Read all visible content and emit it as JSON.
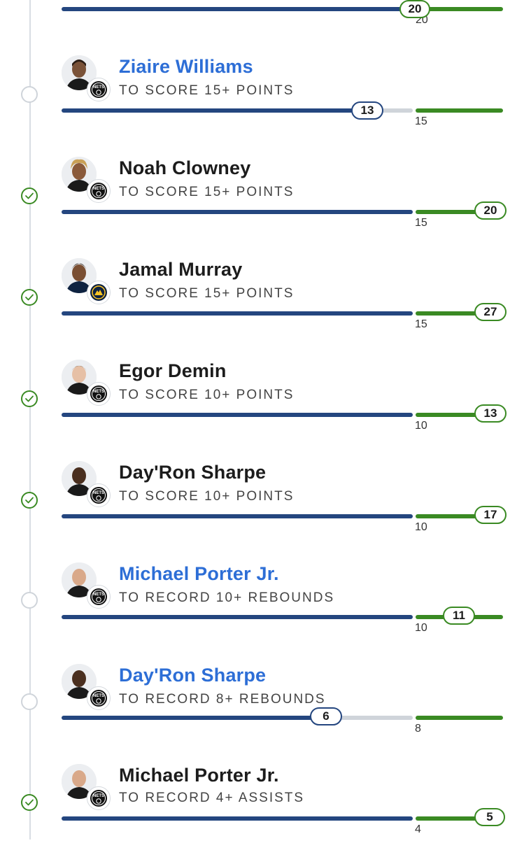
{
  "colors": {
    "progress": "#24467f",
    "remaining": "#cfd4da",
    "target": "#3a8a23",
    "link": "#2d6ed6",
    "timeline": "#d9dde3"
  },
  "top_partial": {
    "current": "20",
    "threshold": "20"
  },
  "props": [
    {
      "player": "Ziaire Williams",
      "team_icon": "nets-logo-icon",
      "prop": "TO SCORE 15+ POINTS",
      "threshold": "15",
      "current": "13",
      "status": "pending",
      "link": true
    },
    {
      "player": "Noah Clowney",
      "team_icon": "nets-logo-icon",
      "prop": "TO SCORE 15+ POINTS",
      "threshold": "15",
      "current": "20",
      "status": "hit",
      "link": false
    },
    {
      "player": "Jamal Murray",
      "team_icon": "nuggets-logo-icon",
      "prop": "TO SCORE 15+ POINTS",
      "threshold": "15",
      "current": "27",
      "status": "hit",
      "link": false
    },
    {
      "player": "Egor Demin",
      "team_icon": "nets-logo-icon",
      "prop": "TO SCORE 10+ POINTS",
      "threshold": "10",
      "current": "13",
      "status": "hit",
      "link": false
    },
    {
      "player": "Day'Ron Sharpe",
      "team_icon": "nets-logo-icon",
      "prop": "TO SCORE 10+ POINTS",
      "threshold": "10",
      "current": "17",
      "status": "hit",
      "link": false
    },
    {
      "player": "Michael Porter Jr.",
      "team_icon": "nets-logo-icon",
      "prop": "TO RECORD 10+ REBOUNDS",
      "threshold": "10",
      "current": "11",
      "status": "pending",
      "link": true
    },
    {
      "player": "Day'Ron Sharpe",
      "team_icon": "nets-logo-icon",
      "prop": "TO RECORD 8+ REBOUNDS",
      "threshold": "8",
      "current": "6",
      "status": "pending",
      "link": true
    },
    {
      "player": "Michael Porter Jr.",
      "team_icon": "nets-logo-icon",
      "prop": "TO RECORD 4+ ASSISTS",
      "threshold": "4",
      "current": "5",
      "status": "hit",
      "link": false
    }
  ]
}
